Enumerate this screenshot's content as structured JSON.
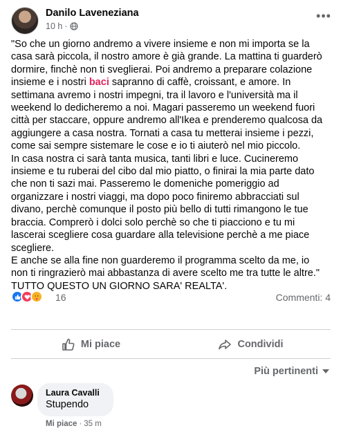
{
  "post": {
    "author": "Danilo Laveneziana",
    "time": "10 h",
    "separator": "·",
    "more_glyph": "•••",
    "text_lines": [
      "\"So che un giorno andremo a vivere insieme e non mi importa se la",
      "casa sarà piccola, il nostro amore è già grande. La mattina ti guarderò",
      "dormire, finchè non ti sveglierai. Poi andremo a preparare colazione"
    ],
    "line4_before": "insieme e i nostri ",
    "line4_highlight": "baci",
    "line4_after": " sapranno di caffè, croissant, e amore. In",
    "text_lines_rest": [
      "settimana avremo i nostri impegni, tra il lavoro e l'università ma il",
      "weekend lo dedicheremo a noi. Magari passeremo un weekend fuori",
      "città per staccare, oppure andremo all'Ikea e prenderemo qualcosa da",
      "aggiungere a casa nostra. Tornati a casa tu metterai insieme i pezzi,",
      "come sai sempre sistemare le cose e io ti aiuterò nel mio piccolo.",
      "In casa nostra ci sarà tanta musica, tanti libri e luce. Cucineremo",
      "insieme e tu ruberai del cibo dal mio piatto, o finirai la mia parte dato",
      "che non ti sazi mai. Passeremo le domeniche pomeriggio ad",
      "organizzare i nostri viaggi, ma dopo poco finiremo abbracciati sul",
      "divano, perchè comunque il posto più bello di tutti rimangono le tue",
      "braccia. Comprerò i dolci solo perchè so che ti piacciono e tu mi",
      "lascerai scegliere cosa guardare alla televisione perchè a me piace",
      "scegliere.",
      "E anche se alla fine non guarderemo il programma scelto da me, io",
      "non ti ringrazierò mai abbastanza di avere scelto me tra tutte le altre.\"",
      "TUTTO QUESTO UN GIORNO SARA' REALTA'."
    ]
  },
  "reactions": {
    "count": "16",
    "comments_label": "Commenti: 4",
    "icons": [
      "like-reaction",
      "love-reaction",
      "care-reaction"
    ]
  },
  "actions": {
    "like_label": "Mi piace",
    "share_label": "Condividi"
  },
  "sort": {
    "label": "Più pertinenti"
  },
  "comment": {
    "author": "Laura Cavalli",
    "text": "Stupendo",
    "like_label": "Mi piace",
    "separator": "·",
    "time": "35 m"
  },
  "colors": {
    "highlight": "#e0245e",
    "secondary_text": "#65676b",
    "like_blue": "#1877f2"
  }
}
